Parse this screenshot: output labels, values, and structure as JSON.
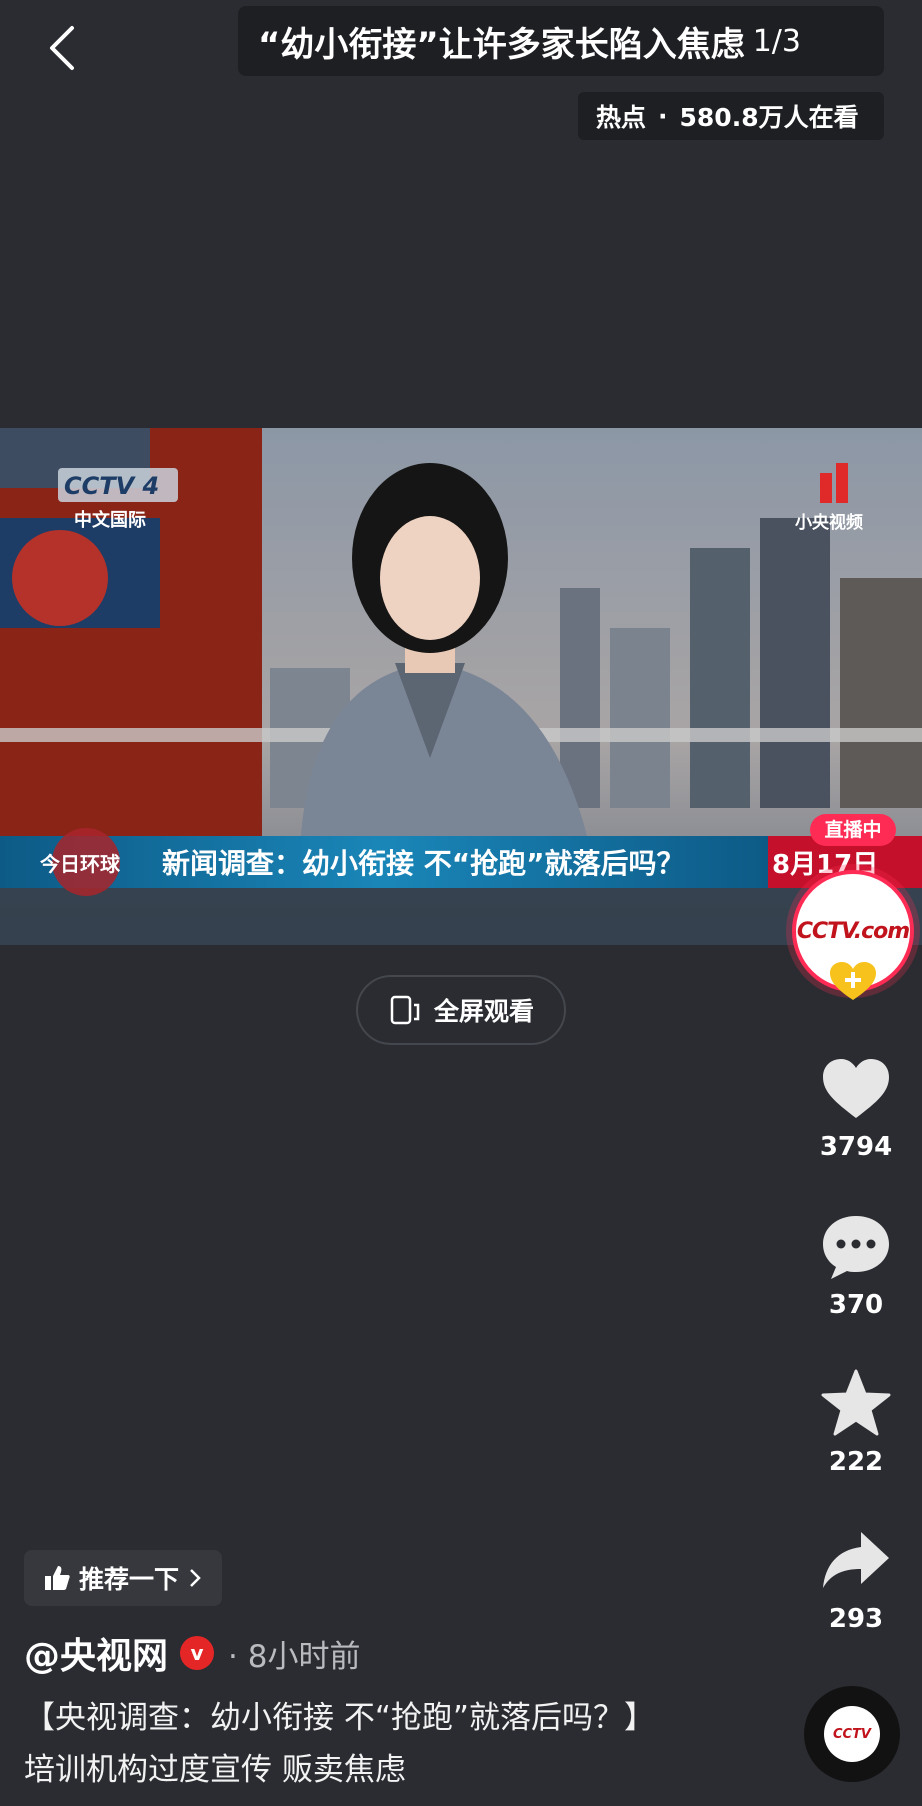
{
  "header": {
    "title": "“幼小衔接”让许多家长陷入焦虑",
    "page_indicator": "1/3",
    "hot_label": "热点",
    "separator": "·",
    "viewers": "580.8万人在看"
  },
  "video": {
    "channel_logo_text": "CCTV 4",
    "channel_sub": "中文国际",
    "watermark": "小央视频",
    "program_logo": "今日环球",
    "ticker_text": "新闻调查：幼小衔接 不“抢跑”就落后吗？",
    "ticker_date": "8月17日",
    "live_badge": "直播中",
    "avatar_logo": "CCTV.com",
    "avatar_sub": "央视网"
  },
  "fullscreen": {
    "label": "全屏观看"
  },
  "actions": {
    "likes": "3794",
    "comments": "370",
    "favorites": "222",
    "shares": "293"
  },
  "recommend": {
    "label": "推荐一下"
  },
  "author": {
    "name": "@央视网",
    "verified_mark": "v",
    "time": "· 8小时前"
  },
  "caption": "【央视调查：幼小衔接 不“抢跑”就落后吗？】培训机构过度宣传 贩卖焦虑",
  "music_disc": {
    "label": "CCTV"
  },
  "colors": {
    "background": "#2a2c31",
    "live_red": "#fe2c55",
    "ticker_blue": "#0f6a9c",
    "verified_red": "#e42626"
  }
}
